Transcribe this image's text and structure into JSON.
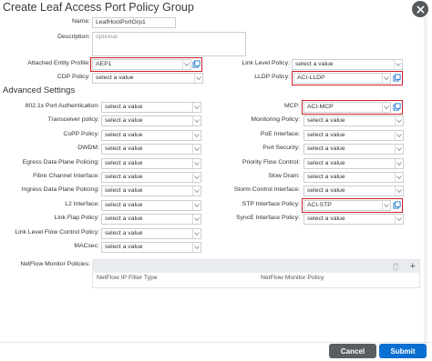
{
  "dialog": {
    "title": "Create Leaf Access Port Policy Group",
    "close_label": "close"
  },
  "name": {
    "label": "Name:",
    "value": "LeafHostPortGrp1"
  },
  "description": {
    "label": "Description:",
    "placeholder": "optional"
  },
  "aep": {
    "label": "Attached Entity Profile:",
    "value": "AEP1"
  },
  "link_level": {
    "label": "Link Level Policy:",
    "value": "select a value"
  },
  "cdp": {
    "label": "CDP Policy:",
    "value": "select a value"
  },
  "lldp": {
    "label": "LLDP Policy:",
    "value": "ACI-LLDP"
  },
  "advanced": {
    "title": "Advanced Settings",
    "left": [
      {
        "label": "802.1x Port Authentication:",
        "value": "select a value"
      },
      {
        "label": "Transceiver policy:",
        "value": "select a value"
      },
      {
        "label": "CoPP Policy:",
        "value": "select a value"
      },
      {
        "label": "DWDM:",
        "value": "select a value"
      },
      {
        "label": "Egress Data Plane Policing:",
        "value": "select a value"
      },
      {
        "label": "Fibre Channel Interface:",
        "value": "select a value"
      },
      {
        "label": "Ingress Data Plane Policing:",
        "value": "select a value"
      },
      {
        "label": "L2 Interface:",
        "value": "select a value"
      },
      {
        "label": "Link Flap Policy:",
        "value": "select a value"
      },
      {
        "label": "Link Level Flow Control Policy:",
        "value": "select a value"
      },
      {
        "label": "MACsec:",
        "value": "select a value"
      }
    ],
    "right": [
      {
        "label": "MCP:",
        "value": "ACI-MCP"
      },
      {
        "label": "Monitoring Policy:",
        "value": "select a value"
      },
      {
        "label": "PoE Interface:",
        "value": "select a value"
      },
      {
        "label": "Port Security:",
        "value": "select a value"
      },
      {
        "label": "Priority Flow Control:",
        "value": "select a value"
      },
      {
        "label": "Slow Drain:",
        "value": "select a value"
      },
      {
        "label": "Storm Control Interface:",
        "value": "select a value"
      },
      {
        "label": "STP Interface Policy:",
        "value": "ACI-STP"
      },
      {
        "label": "SyncE Interface Policy:",
        "value": "select a value"
      }
    ]
  },
  "netflow": {
    "label": "NetFlow Monitor Policies:",
    "columns": [
      "NetFlow IP Filter Type",
      "NetFlow Monitor Policy"
    ]
  },
  "footer": {
    "cancel": "Cancel",
    "submit": "Submit"
  },
  "colors": {
    "highlight": "#d0202a",
    "primary": "#0a6fd1",
    "secondary": "#5a5e63"
  },
  "icons": [
    "close-icon",
    "chevron-down-icon",
    "external-link-icon",
    "trash-icon",
    "plus-icon"
  ]
}
